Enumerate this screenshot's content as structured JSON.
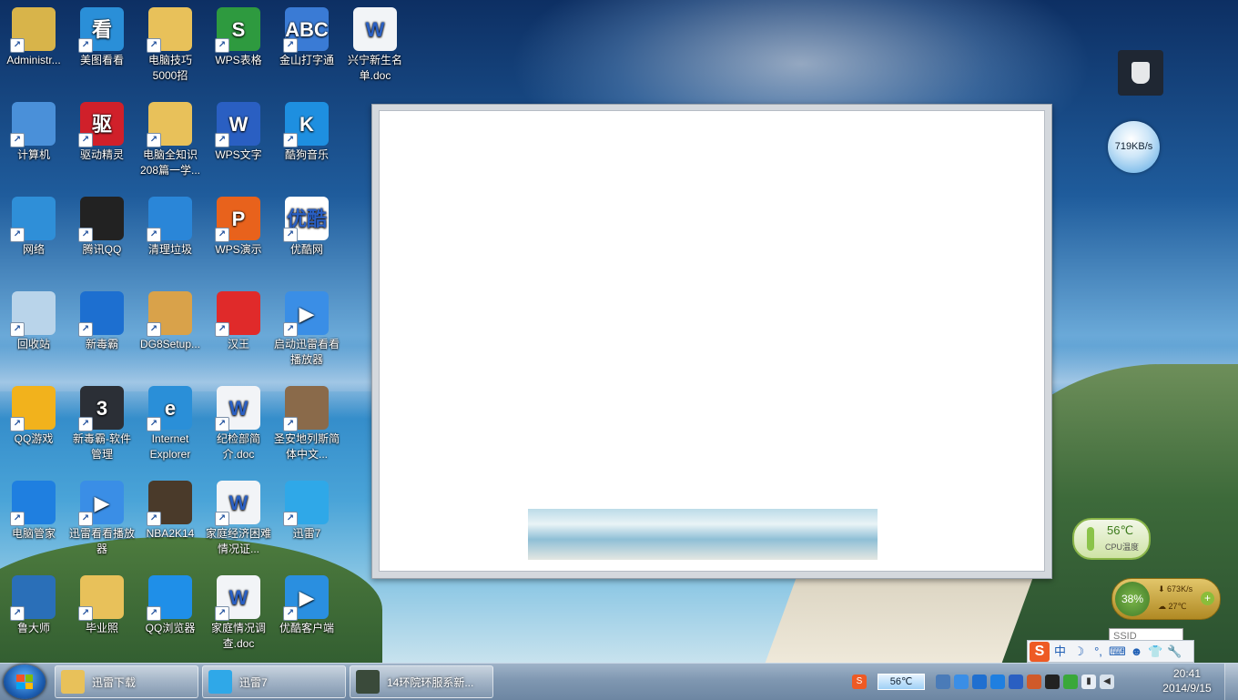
{
  "desktop": {
    "icons": [
      {
        "label": "Administr...",
        "icon": "user-folder-icon",
        "color": "#d8b44a"
      },
      {
        "label": "美图看看",
        "icon": "meitu-viewer-icon",
        "color": "#2a8fd8"
      },
      {
        "label": "电脑技巧5000招",
        "icon": "folder-icon",
        "color": "#e8c15a"
      },
      {
        "label": "WPS表格",
        "icon": "wps-spreadsheet-icon",
        "color": "#2e9a3f"
      },
      {
        "label": "金山打字通",
        "icon": "typing-abc-icon",
        "color": "#3a7bd5"
      },
      {
        "label": "兴宁新生名单.doc",
        "icon": "word-doc-icon",
        "color": "#f2f4f7"
      },
      {
        "label": "计算机",
        "icon": "computer-icon",
        "color": "#4a90d9"
      },
      {
        "label": "驱动精灵",
        "icon": "driver-genius-icon",
        "color": "#d0202a"
      },
      {
        "label": "电脑全知识208篇一学...",
        "icon": "folder-icon",
        "color": "#e8c15a"
      },
      {
        "label": "WPS文字",
        "icon": "wps-writer-icon",
        "color": "#2a5fc2"
      },
      {
        "label": "酷狗音乐",
        "icon": "kugou-icon",
        "color": "#1e8fe0"
      },
      {
        "label": "网络",
        "icon": "network-globe-icon",
        "color": "#2f8fd8"
      },
      {
        "label": "腾讯QQ",
        "icon": "qq-penguin-icon",
        "color": "#222222"
      },
      {
        "label": "清理垃圾",
        "icon": "recycle-clean-icon",
        "color": "#2a86d8"
      },
      {
        "label": "WPS演示",
        "icon": "wps-presentation-icon",
        "color": "#e8621c"
      },
      {
        "label": "优酷网",
        "icon": "youku-icon",
        "color": "#ffffff"
      },
      {
        "label": "回收站",
        "icon": "recycle-bin-icon",
        "color": "#b9d4ea"
      },
      {
        "label": "新毒霸",
        "icon": "duba-antivirus-icon",
        "color": "#1d6fd0"
      },
      {
        "label": "DG8Setup...",
        "icon": "installer-box-icon",
        "color": "#d9a24a"
      },
      {
        "label": "汉王",
        "icon": "hanwang-icon",
        "color": "#e02a2a"
      },
      {
        "label": "启动迅雷看看播放器",
        "icon": "xunlei-player-icon",
        "color": "#3a8ee6"
      },
      {
        "label": "QQ游戏",
        "icon": "qq-game-icon",
        "color": "#f2b21c"
      },
      {
        "label": "新毒霸-软件管理",
        "icon": "software-manager-icon",
        "color": "#2b2f36"
      },
      {
        "label": "Internet Explorer",
        "icon": "ie-icon",
        "color": "#2a8fd8"
      },
      {
        "label": "纪检部简介.doc",
        "icon": "word-doc-icon",
        "color": "#f2f4f7"
      },
      {
        "label": "圣安地列斯简体中文...",
        "icon": "gta-game-icon",
        "color": "#8a6a4a"
      },
      {
        "label": "电脑管家",
        "icon": "pc-manager-icon",
        "color": "#1f7fe0"
      },
      {
        "label": "迅雷看看播放器",
        "icon": "xunlei-player-icon",
        "color": "#3a8ee6"
      },
      {
        "label": "NBA2K14",
        "icon": "nba2k14-icon",
        "color": "#4a3a2a"
      },
      {
        "label": "家庭经济困难情况证...",
        "icon": "word-doc-icon",
        "color": "#f2f4f7"
      },
      {
        "label": "迅雷7",
        "icon": "thunder-bird-icon",
        "color": "#2fa8e8"
      },
      {
        "label": "鲁大师",
        "icon": "ludashi-icon",
        "color": "#2a6fb8"
      },
      {
        "label": "毕业照",
        "icon": "folder-icon",
        "color": "#e8c15a"
      },
      {
        "label": "QQ浏览器",
        "icon": "qq-browser-icon",
        "color": "#1f8fe8"
      },
      {
        "label": "家庭情况调查.doc",
        "icon": "word-doc-icon",
        "color": "#f2f4f7"
      },
      {
        "label": "优酷客户端",
        "icon": "youku-client-icon",
        "color": "#2a8fe0"
      }
    ],
    "icon_letters": [
      "",
      "看",
      "",
      "S",
      "ABC",
      "W",
      "",
      "驱",
      "",
      "W",
      "K",
      "",
      "",
      "",
      "P",
      "优酷",
      "",
      "",
      "",
      "",
      "▶",
      "",
      "3",
      "e",
      "W",
      "",
      "",
      "▶",
      "",
      "W",
      "",
      "",
      "",
      "",
      "W",
      "▶"
    ]
  },
  "widgets": {
    "net_speed": "719KB/s",
    "cpu_temp": "56℃",
    "cpu_temp_label": "CPU温度",
    "memory_pct": "38%",
    "download_rate": "673K/s",
    "board_temp": "27℃",
    "ssid_placeholder": "SSID"
  },
  "ime": {
    "logo": "S",
    "mode": "中"
  },
  "taskbar": {
    "tasks": [
      {
        "label": "迅雷下载",
        "icon": "folder-icon"
      },
      {
        "label": "迅雷7",
        "icon": "thunder-bird-icon"
      },
      {
        "label": "14环院环服系新...",
        "icon": "video-thumbnail-icon"
      }
    ],
    "cpu_temp": "56℃",
    "time": "20:41",
    "date": "2014/9/15"
  },
  "colors": {
    "taskbar": "#7f97b1",
    "accent": "#1d5fb3"
  }
}
